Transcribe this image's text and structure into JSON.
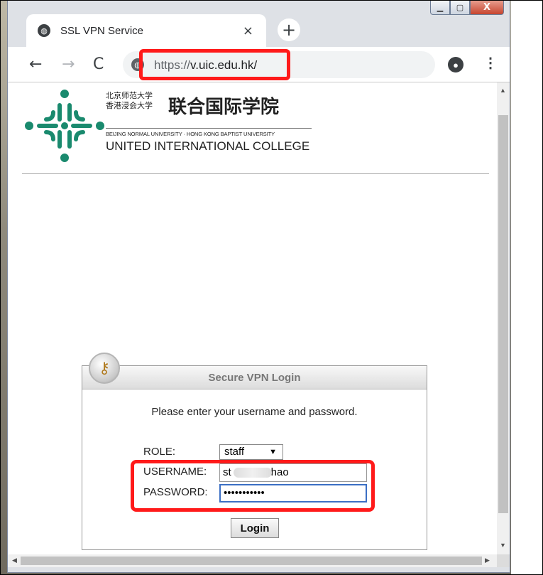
{
  "window": {
    "controls": {
      "minimize": "▁",
      "maximize": "▢",
      "close": "X"
    }
  },
  "tab": {
    "title": "SSL VPN Service",
    "close": "×",
    "new_tab": "+"
  },
  "toolbar": {
    "back": "←",
    "forward": "→",
    "reload": "C",
    "url_scheme": "https://",
    "url_host": "v.uic.edu.hk/",
    "menu": "⋮"
  },
  "logo": {
    "cn_line1": "北京师范大学",
    "cn_line2": "香港浸会大学",
    "cn_name": "联合国际学院",
    "en_small": "BEIJING NORMAL UNIVERSITY · HONG KONG BAPTIST UNIVERSITY",
    "en_name": "UNITED INTERNATIONAL COLLEGE",
    "color": "#1a8a6e"
  },
  "login": {
    "header": "Secure VPN Login",
    "instruction": "Please enter your username and password.",
    "role_label": "ROLE:",
    "role_value": "staff",
    "username_label": "USERNAME:",
    "username_prefix": "st",
    "username_suffix": "hao",
    "password_label": "PASSWORD:",
    "password_value": "•••••••••••",
    "submit": "Login"
  },
  "highlight_color": "#ff1a1a"
}
